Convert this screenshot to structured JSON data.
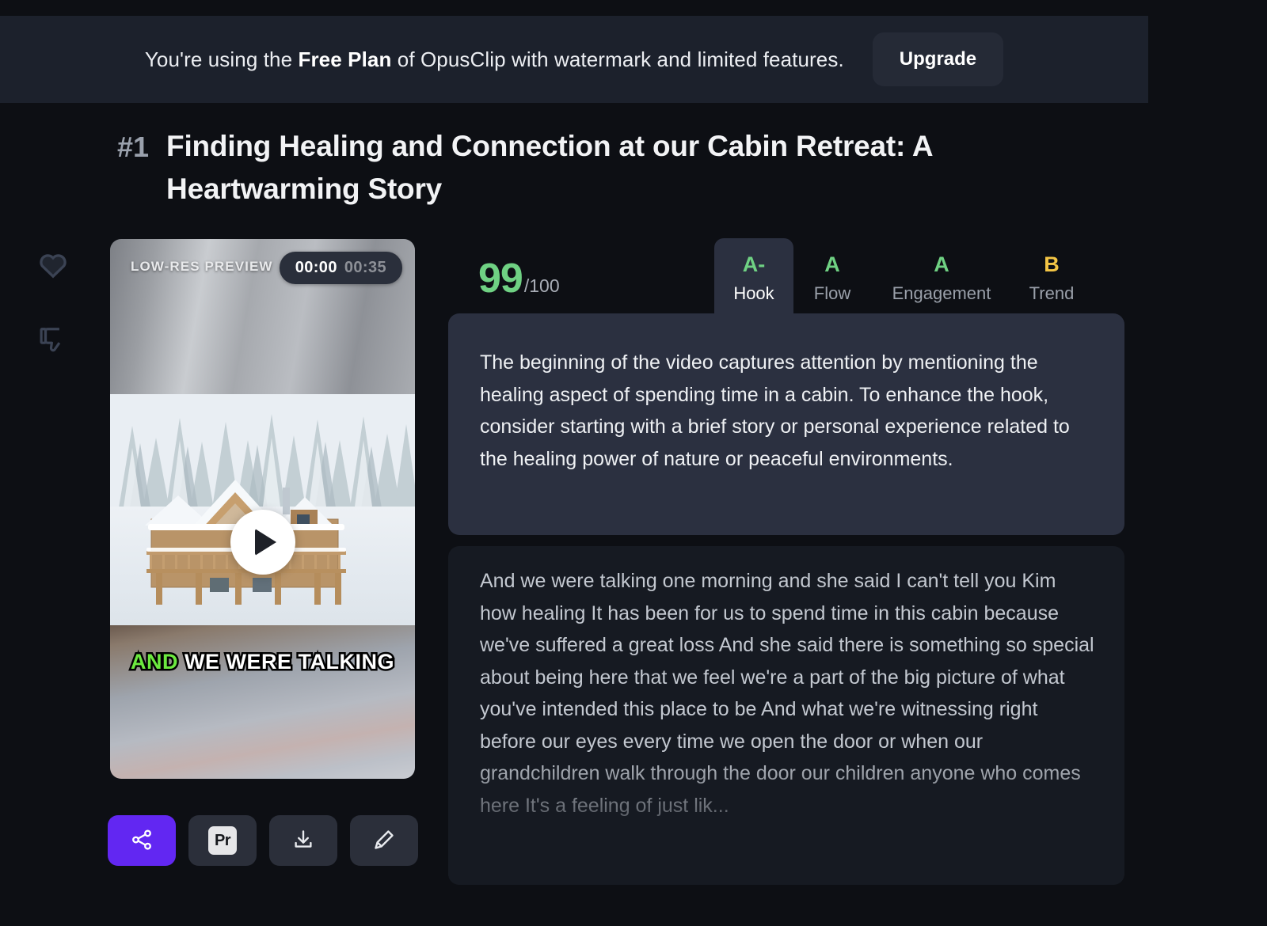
{
  "banner": {
    "text_before": "You're using the ",
    "plan": "Free Plan",
    "text_after": " of OpusClip with watermark and limited features.",
    "upgrade_label": "Upgrade"
  },
  "clip": {
    "rank": "#1",
    "title": "Finding Healing and Connection at our Cabin Retreat: A Heartwarming Story"
  },
  "rail": {
    "like_icon": "heart-icon",
    "dislike_icon": "thumbs-down-icon"
  },
  "video": {
    "preview_badge": "LOW-RES PREVIEW",
    "current_time": "00:00",
    "duration": "00:35",
    "play_icon": "play-icon",
    "caption_highlight": "AND",
    "caption_rest": "WE WERE TALKING"
  },
  "actions": [
    {
      "name": "share-button",
      "icon": "share-icon",
      "label": ""
    },
    {
      "name": "premiere-button",
      "icon": "premiere-icon",
      "label": "Pr"
    },
    {
      "name": "download-button",
      "icon": "download-icon",
      "label": ""
    },
    {
      "name": "edit-button",
      "icon": "pencil-icon",
      "label": ""
    }
  ],
  "score": {
    "value": "99",
    "max": "/100",
    "color": "#6fd183"
  },
  "tabs": [
    {
      "label": "Hook",
      "grade": "A-",
      "grade_color": "#6fd183",
      "active": true
    },
    {
      "label": "Flow",
      "grade": "A",
      "grade_color": "#6fd183",
      "active": false
    },
    {
      "label": "Engagement",
      "grade": "A",
      "grade_color": "#6fd183",
      "active": false
    },
    {
      "label": "Trend",
      "grade": "B",
      "grade_color": "#f3c545",
      "active": false
    }
  ],
  "hook": {
    "description": "The beginning of the video captures attention by mentioning the healing aspect of spending time in a cabin. To enhance the hook, consider starting with a brief story or personal experience related to the healing power of nature or peaceful environments."
  },
  "transcript": {
    "text": "And we were talking one morning and she said I can't tell you Kim how healing It has been for us to spend time in this cabin because we've suffered a great loss And she said there is something so special about being here that we feel we're a part of the big picture of what you've intended this place to be And what we're witnessing right before our eyes every time we open the door or when our grandchildren walk through the door our children anyone who comes here It's a feeling of just lik..."
  },
  "colors": {
    "page_background": "#0d0f14",
    "banner_background": "#1c212c",
    "panel_background": "#2b3040",
    "transcript_background": "#161a22",
    "accent_purple": "#6227f2",
    "grade_green": "#6fd183",
    "grade_gold": "#f3c545",
    "caption_green": "#6ce93f"
  }
}
